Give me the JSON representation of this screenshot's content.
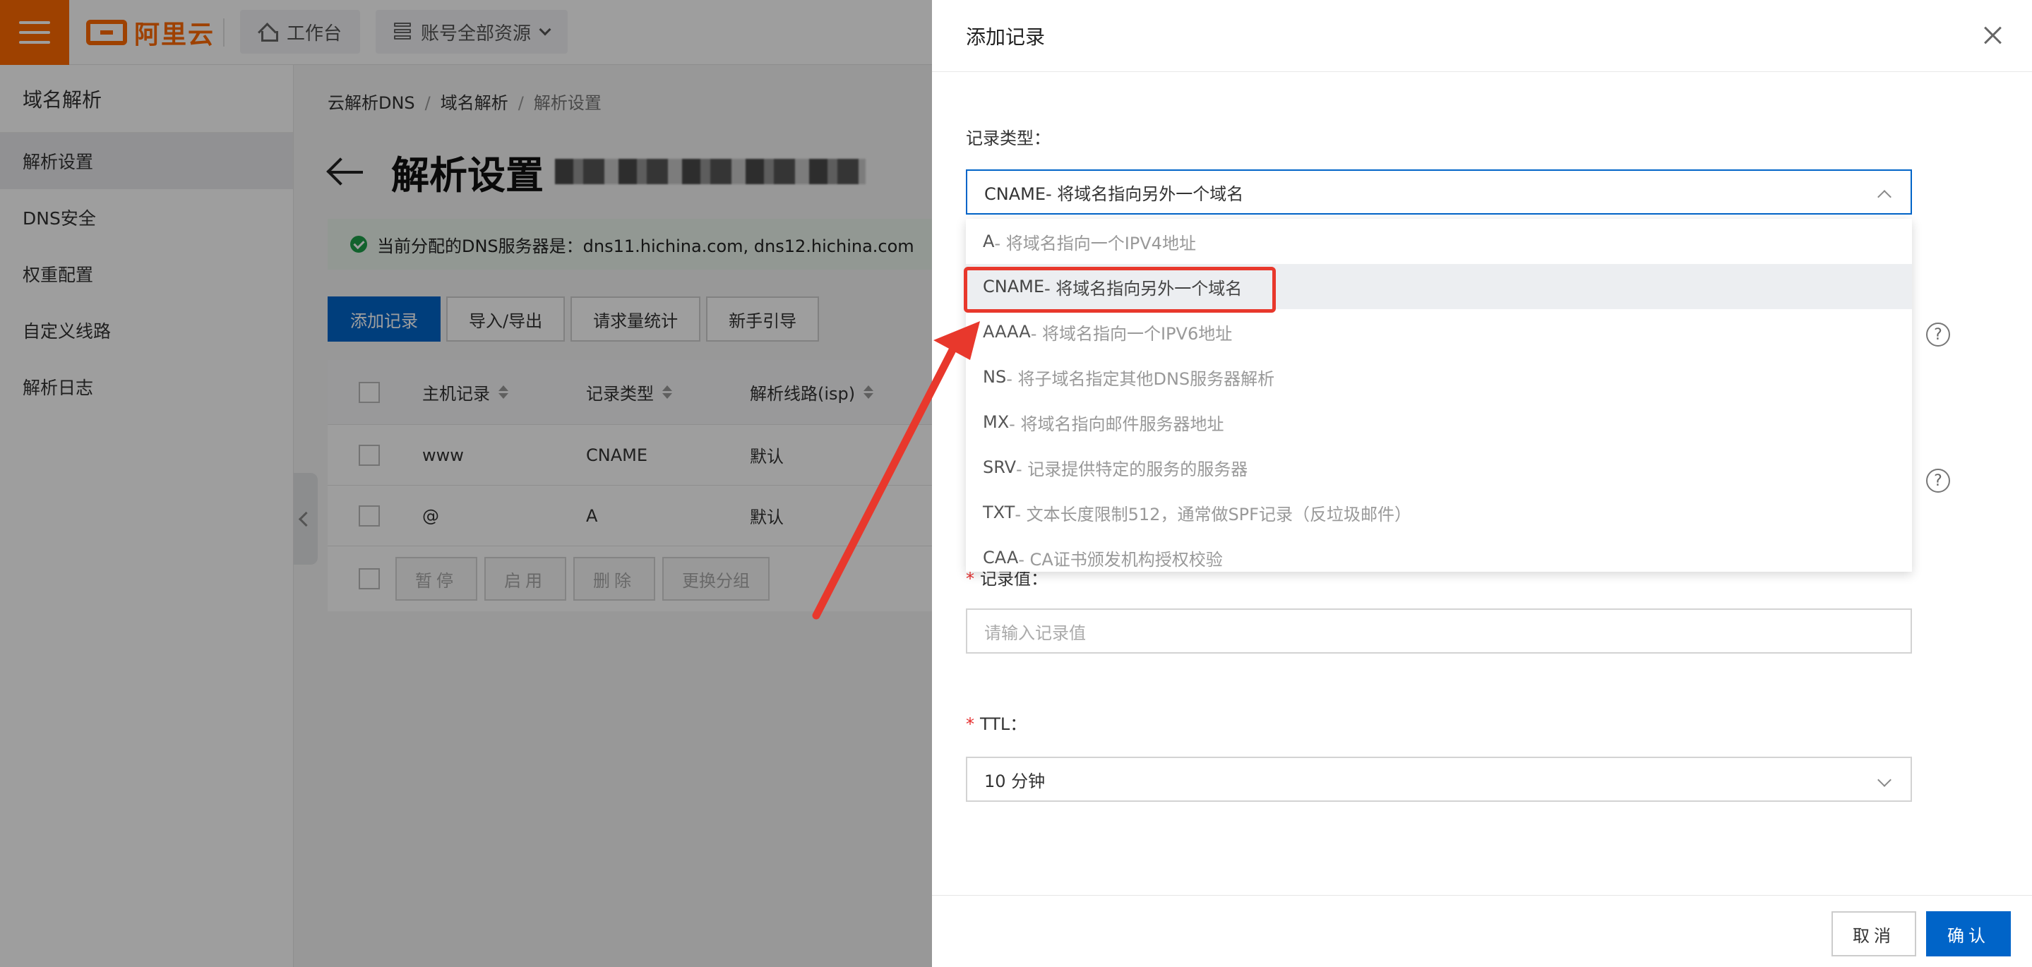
{
  "topbar": {
    "brand": "阿里云",
    "workbench_label": "工作台",
    "resources_label": "账号全部资源"
  },
  "sidebar": {
    "title": "域名解析",
    "items": [
      {
        "label": "解析设置",
        "active": true
      },
      {
        "label": "DNS安全"
      },
      {
        "label": "权重配置"
      },
      {
        "label": "自定义线路"
      },
      {
        "label": "解析日志"
      }
    ]
  },
  "breadcrumb": [
    "云解析DNS",
    "域名解析",
    "解析设置"
  ],
  "page": {
    "title": "解析设置",
    "notice": "当前分配的DNS服务器是：dns11.hichina.com, dns12.hichina.com"
  },
  "actions": [
    "添加记录",
    "导入/导出",
    "请求量统计",
    "新手引导"
  ],
  "table": {
    "columns": [
      "主机记录",
      "记录类型",
      "解析线路(isp)"
    ],
    "rows": [
      {
        "host": "www",
        "type": "CNAME",
        "line": "默认"
      },
      {
        "host": "@",
        "type": "A",
        "line": "默认"
      }
    ],
    "footer_buttons": [
      "暂停",
      "启用",
      "删除",
      "更换分组"
    ]
  },
  "drawer": {
    "title": "添加记录",
    "record_type_label": "记录类型：",
    "record_type_value": "CNAME- 将域名指向另外一个域名",
    "options": [
      {
        "code": "A",
        "desc": "- 将域名指向一个IPV4地址"
      },
      {
        "code": "CNAME",
        "desc": "- 将域名指向另外一个域名",
        "selected": true
      },
      {
        "code": "AAAA",
        "desc": "- 将域名指向一个IPV6地址"
      },
      {
        "code": "NS",
        "desc": "- 将子域名指定其他DNS服务器解析"
      },
      {
        "code": "MX",
        "desc": "- 将域名指向邮件服务器地址"
      },
      {
        "code": "SRV",
        "desc": "- 记录提供特定的服务的服务器"
      },
      {
        "code": "TXT",
        "desc": "- 文本长度限制512，通常做SPF记录（反垃圾邮件）"
      },
      {
        "code": "CAA",
        "desc": "- CA证书颁发机构授权校验"
      }
    ],
    "record_value_label": "记录值：",
    "record_value_placeholder": "请输入记录值",
    "ttl_label": "TTL：",
    "ttl_value": "10 分钟",
    "cancel_label": "取消",
    "confirm_label": "确认"
  },
  "colors": {
    "brand_orange": "#ff6a00",
    "primary_blue": "#0064c8",
    "annotation_red": "#e8382c",
    "success_green": "#1e9e4a"
  }
}
